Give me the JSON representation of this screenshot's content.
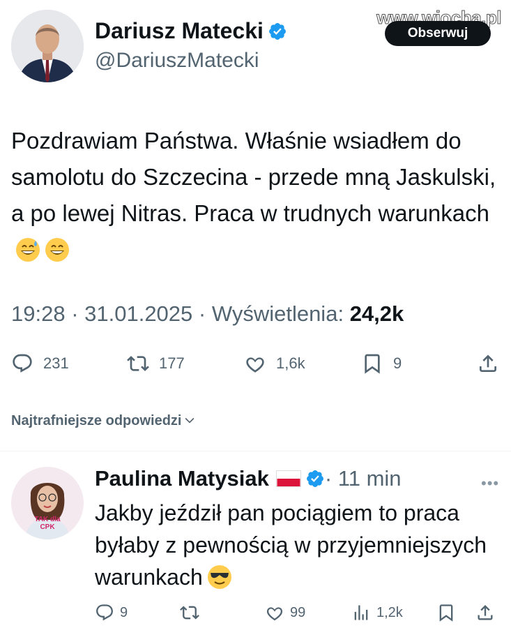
{
  "watermark": "www.wiocha.pl",
  "tweet": {
    "author_name": "Dariusz Matecki",
    "author_handle": "@DariuszMatecki",
    "follow_label": "Obserwuj",
    "text": "Pozdrawiam Państwa. Właśnie wsiadłem do samolotu do Szczecina - przede mną Jaskulski, a po lewej Nitras. Praca w trudnych warunkach",
    "emojis": [
      "grinning-sweat-emoji",
      "grinning-smile-emoji"
    ],
    "time_date": "19:28 · 31.01.2025 · ",
    "views_label": "Wyświetlenia:",
    "views_count": "24,2k",
    "reply_count": "231",
    "retweet_count": "177",
    "like_count": "1,6k",
    "bookmark_count": "9"
  },
  "replies_section": {
    "header": "Najtrafniejsze odpowiedzi"
  },
  "reply": {
    "author_name": "Paulina Matysiak",
    "time": "· 11 min",
    "text": "Jakby jeździł pan pociągiem to praca byłaby z pewnością w przyjemniejszych warunkach",
    "emoji": "sunglasses-emoji",
    "avatar_caption": "TAK dla CPK",
    "reply_count": "9",
    "retweet_count": "",
    "like_count": "99",
    "views_count": "1,2k"
  },
  "colors": {
    "text": "#0f1419",
    "secondary": "#536471",
    "verified": "#1d9bf0",
    "button_bg": "#0f1419"
  }
}
